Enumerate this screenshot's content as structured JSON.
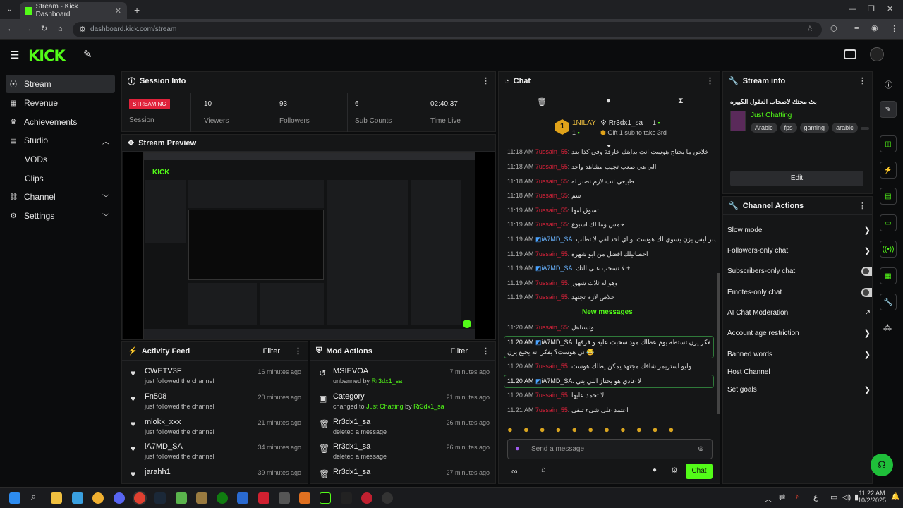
{
  "browser": {
    "tab_title": "Stream - Kick Dashboard",
    "url": "dashboard.kick.com/stream"
  },
  "logo": "KICK",
  "sidebar": [
    {
      "label": "Stream"
    },
    {
      "label": "Revenue"
    },
    {
      "label": "Achievements"
    },
    {
      "label": "Studio"
    },
    {
      "label": "VODs"
    },
    {
      "label": "Clips"
    },
    {
      "label": "Channel"
    },
    {
      "label": "Settings"
    }
  ],
  "session": {
    "title": "Session Info",
    "badge": "STREAMING",
    "label": "Session",
    "stats": [
      {
        "value": "10",
        "label": "Viewers"
      },
      {
        "value": "93",
        "label": "Followers"
      },
      {
        "value": "6",
        "label": "Sub Counts"
      },
      {
        "value": "02:40:37",
        "label": "Time Live"
      }
    ]
  },
  "preview": {
    "title": "Stream Preview"
  },
  "activity": {
    "title": "Activity Feed",
    "filter": "Filter",
    "items": [
      {
        "name": "CWETV3F",
        "desc": "just followed the channel",
        "time": "16 minutes ago"
      },
      {
        "name": "Fn508",
        "desc": "just followed the channel",
        "time": "20 minutes ago"
      },
      {
        "name": "mlokk_xxx",
        "desc": "just followed the channel",
        "time": "21 minutes ago"
      },
      {
        "name": "iA7MD_SA",
        "desc": "just followed the channel",
        "time": "34 minutes ago"
      },
      {
        "name": "jarahh1",
        "desc": "",
        "time": "39 minutes ago"
      }
    ]
  },
  "mod": {
    "title": "Mod Actions",
    "filter": "Filter",
    "items": [
      {
        "name": "MSIEVOA",
        "desc": "unbanned by",
        "by": "Rr3dx1_sa",
        "time": "7 minutes ago"
      },
      {
        "name": "Category",
        "desc": "changed to",
        "cat": "Just Chatting",
        "by_word": "by",
        "by": "Rr3dx1_sa",
        "time": "21 minutes ago"
      },
      {
        "name": "Rr3dx1_sa",
        "desc": "deleted a message",
        "time": "26 minutes ago"
      },
      {
        "name": "Rr3dx1_sa",
        "desc": "deleted a message",
        "time": "26 minutes ago"
      },
      {
        "name": "Rr3dx1_sa",
        "desc": "",
        "time": "27 minutes ago"
      }
    ]
  },
  "chat": {
    "title": "Chat",
    "pin_user1": "1NILAY",
    "pin_user2": "Rr3dx1_sa",
    "pin_count1": "1",
    "pin_count2": "1",
    "gift_text": "Gift 1 sub to take 3rd",
    "messages": [
      {
        "time": "11:18 AM",
        "user": "7ussain_55",
        "msg": "خلاص ما يحتاج هوست انت بدايتك خارقة وفي كذا بعد"
      },
      {
        "time": "11:18 AM",
        "user": "7ussain_55",
        "msg": "الي هي صعب تجيب مشاهد واحد"
      },
      {
        "time": "11:18 AM",
        "user": "7ussain_55",
        "msg": "طبيعي انت لازم تصبر له"
      },
      {
        "time": "11:18 AM",
        "user": "7ussain_55",
        "msg": "سم"
      },
      {
        "time": "11:19 AM",
        "user": "7ussain_55",
        "msg": "تسوق امها"
      },
      {
        "time": "11:19 AM",
        "user": "7ussain_55",
        "msg": "خمس وما لك اسبوع"
      },
      {
        "time": "11:19 AM",
        "user": "iA7MD_SA",
        "msg": "انت اسبر ليس يزن يسوي لك هوست او اي احد لقي لا تطلب"
      },
      {
        "time": "11:19 AM",
        "user": "7ussain_55",
        "msg": "احصائيلك افضل من ابو شهره"
      },
      {
        "time": "11:19 AM",
        "user": "iA7MD_SA",
        "msg": "لا تسحب على التك +"
      },
      {
        "time": "11:19 AM",
        "user": "7ussain_55",
        "msg": "وهو له ثلاث شهور"
      },
      {
        "time": "11:19 AM",
        "user": "7ussain_55",
        "msg": "خلاص لازم تجتهد"
      }
    ],
    "new_messages": "New messages",
    "messages2": [
      {
        "time": "11:20 AM",
        "user": "7ussain_55",
        "msg": "وتستاهل"
      },
      {
        "time": "11:20 AM",
        "user": "iA7MD_SA",
        "msg": "عشان لا يفكر يزن تستطه يوم عطاك مود سحبت عليه و فرقها"
      },
      {
        "time": "",
        "user": "",
        "msg": "ني هوست؟ يفكر انه يجيع يزن 😂"
      },
      {
        "time": "11:20 AM",
        "user": "7ussain_55",
        "msg": "وليو استريمر شافك مجتهد يمكن يطلك هوست"
      },
      {
        "time": "11:20 AM",
        "user": "iA7MD_SA",
        "msg": "لا عادي هو يحتاز اللي بني"
      },
      {
        "time": "11:20 AM",
        "user": "7ussain_55",
        "msg": "لا تحمد عليها"
      },
      {
        "time": "11:21 AM",
        "user": "7ussain_55",
        "msg": "اعتمد على شيء تلقي"
      }
    ],
    "input_placeholder": "Send a message",
    "send": "Chat"
  },
  "streaminfo": {
    "title": "Stream info",
    "stream_title": "بث محتك لاصحاب العقول الكبيره",
    "category": "Just Chatting",
    "tags": [
      "Arabic",
      "fps",
      "gaming",
      "arabic"
    ],
    "edit": "Edit"
  },
  "channel_actions": {
    "title": "Channel Actions",
    "items": [
      "Slow mode",
      "Followers-only chat",
      "Subscribers-only chat",
      "Emotes-only chat",
      "AI Chat Moderation",
      "Account age restriction",
      "Banned words",
      "Host Channel",
      "Set goals"
    ]
  },
  "taskbar": {
    "time": "11:22 AM",
    "date": "10/2/2025",
    "lang": "ع"
  },
  "colors": {
    "accent": "#53fc18",
    "live": "#e0223b"
  }
}
